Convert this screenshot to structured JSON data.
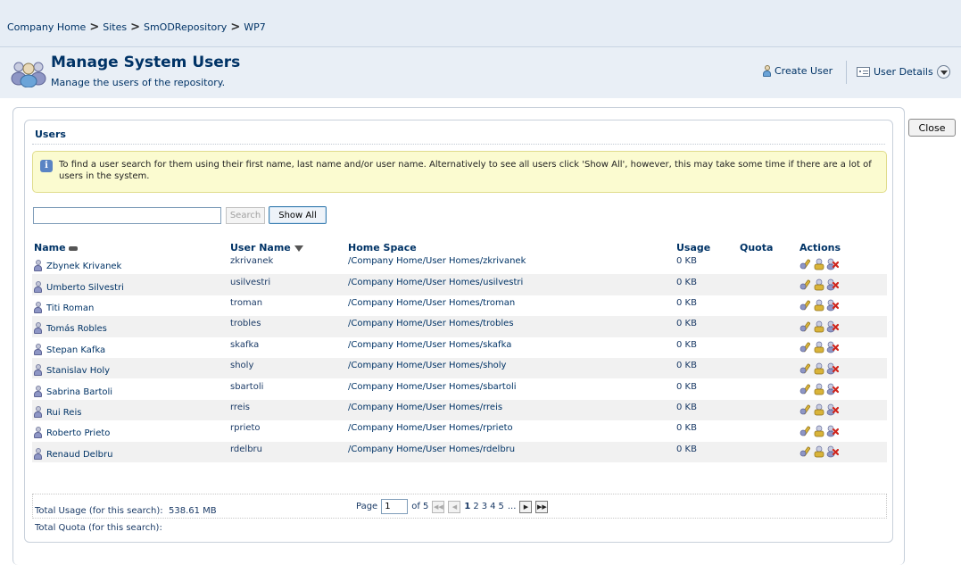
{
  "breadcrumb": {
    "items": [
      "Company Home",
      "Sites",
      "SmODRepository",
      "WP7"
    ],
    "separator": ">"
  },
  "header": {
    "title": "Manage System Users",
    "subtitle": "Manage the users of the repository.",
    "create_user_label": "Create User",
    "user_details_label": "User Details"
  },
  "close_label": "Close",
  "users_panel": {
    "heading": "Users",
    "info_text": "To find a user search for them using their first name, last name and/or user name. Alternatively to see all users click 'Show All', however, this may take some time if there are a lot of users in the system.",
    "search_value": "",
    "search_label": "Search",
    "show_all_label": "Show All"
  },
  "table": {
    "columns": {
      "name": "Name",
      "user_name": "User Name",
      "home_space": "Home Space",
      "usage": "Usage",
      "quota": "Quota",
      "actions": "Actions"
    },
    "rows": [
      {
        "name": "Zbynek Krivanek",
        "user_name": "zkrivanek",
        "home": "/Company Home/User Homes/zkrivanek",
        "usage": "0 KB",
        "quota": ""
      },
      {
        "name": "Umberto Silvestri",
        "user_name": "usilvestri",
        "home": "/Company Home/User Homes/usilvestri",
        "usage": "0 KB",
        "quota": ""
      },
      {
        "name": "Titi Roman",
        "user_name": "troman",
        "home": "/Company Home/User Homes/troman",
        "usage": "0 KB",
        "quota": ""
      },
      {
        "name": "Tomás Robles",
        "user_name": "trobles",
        "home": "/Company Home/User Homes/trobles",
        "usage": "0 KB",
        "quota": ""
      },
      {
        "name": "Stepan Kafka",
        "user_name": "skafka",
        "home": "/Company Home/User Homes/skafka",
        "usage": "0 KB",
        "quota": ""
      },
      {
        "name": "Stanislav Holy",
        "user_name": "sholy",
        "home": "/Company Home/User Homes/sholy",
        "usage": "0 KB",
        "quota": ""
      },
      {
        "name": "Sabrina Bartoli",
        "user_name": "sbartoli",
        "home": "/Company Home/User Homes/sbartoli",
        "usage": "0 KB",
        "quota": ""
      },
      {
        "name": "Rui Reis",
        "user_name": "rreis",
        "home": "/Company Home/User Homes/rreis",
        "usage": "0 KB",
        "quota": ""
      },
      {
        "name": "Roberto Prieto",
        "user_name": "rprieto",
        "home": "/Company Home/User Homes/rprieto",
        "usage": "0 KB",
        "quota": ""
      },
      {
        "name": "Renaud Delbru",
        "user_name": "rdelbru",
        "home": "/Company Home/User Homes/rdelbru",
        "usage": "0 KB",
        "quota": ""
      }
    ],
    "action_icons": [
      "edit-user-icon",
      "change-password-icon",
      "delete-user-icon"
    ]
  },
  "pager": {
    "page_label": "Page",
    "current_page": "1",
    "of_label": "of 5",
    "pages": [
      "1",
      "2",
      "3",
      "4",
      "5"
    ],
    "ellipsis": "..."
  },
  "totals": {
    "usage_label": "Total Usage (for this search):",
    "usage_value": "538.61 MB",
    "quota_label": "Total Quota (for this search):",
    "quota_value": ""
  },
  "colors": {
    "link": "#003366",
    "header_bg": "#e9eff6",
    "info_bg": "#fbfbd0",
    "delete_red": "#d0261d"
  }
}
